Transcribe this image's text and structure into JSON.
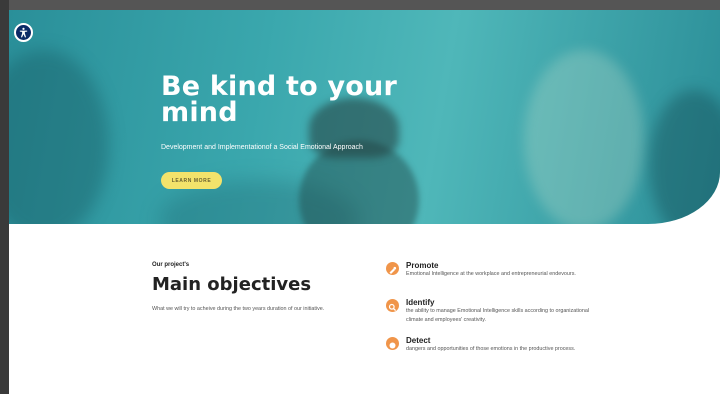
{
  "accessibility": {
    "icon": "accessibility-icon"
  },
  "hero": {
    "title": "Be kind to your mind",
    "subtitle": "Development and Implementationof a Social Emotional Approach",
    "cta_label": "LEARN MORE",
    "cta_color": "#f3e36b",
    "background_color": "#3aa7ad"
  },
  "objectives": {
    "eyebrow": "Our project's",
    "title": "Main objectives",
    "description": "What we will try to acheive during the two years duration of our initiative.",
    "items": [
      {
        "title": "Promote",
        "text": "Emotional Intelligence at the workplace and entrepreneurial endevours.",
        "icon": "promote-icon"
      },
      {
        "title": "Identify",
        "text": "the ability to manage Emotional Intelligence skills according to organizational climate and employees' creativity.",
        "icon": "search-icon"
      },
      {
        "title": "Detect",
        "text": "dangers and opportunities of those emotions in the productive process.",
        "icon": "detect-icon"
      }
    ],
    "accent_color": "#f0954a"
  }
}
